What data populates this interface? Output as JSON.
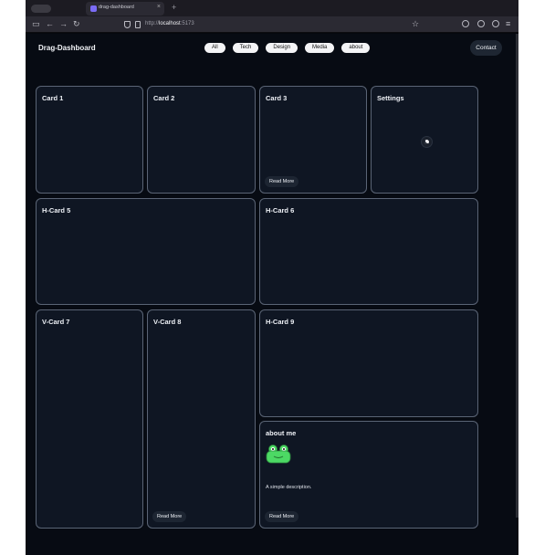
{
  "browser": {
    "tab_title": "drag-dashboard",
    "url_prefix": "http://",
    "url_host": "localhost",
    "url_port": ":5173"
  },
  "header": {
    "brand": "Drag-Dashboard",
    "filters": [
      "All",
      "Tech",
      "Design",
      "Media",
      "about"
    ],
    "contact_label": "Contact"
  },
  "cards": [
    {
      "title": "Card 1"
    },
    {
      "title": "Card 2"
    },
    {
      "title": "Card 3",
      "button": "Read More"
    },
    {
      "title": "Settings",
      "icon": "moon-icon"
    },
    {
      "title": "H-Card 5"
    },
    {
      "title": "H-Card 6"
    },
    {
      "title": "V-Card 7"
    },
    {
      "title": "V-Card 8",
      "button": "Read More"
    },
    {
      "title": "H-Card 9"
    },
    {
      "title": "about me",
      "icon": "frog-icon",
      "description": "A simple description.",
      "button": "Read More"
    }
  ],
  "colors": {
    "page_bg": "#070b13",
    "card_bg": "#0f1623",
    "card_border": "#5a6475",
    "pill_bg": "#f4f4f6",
    "frog_green": "#4cd964"
  }
}
